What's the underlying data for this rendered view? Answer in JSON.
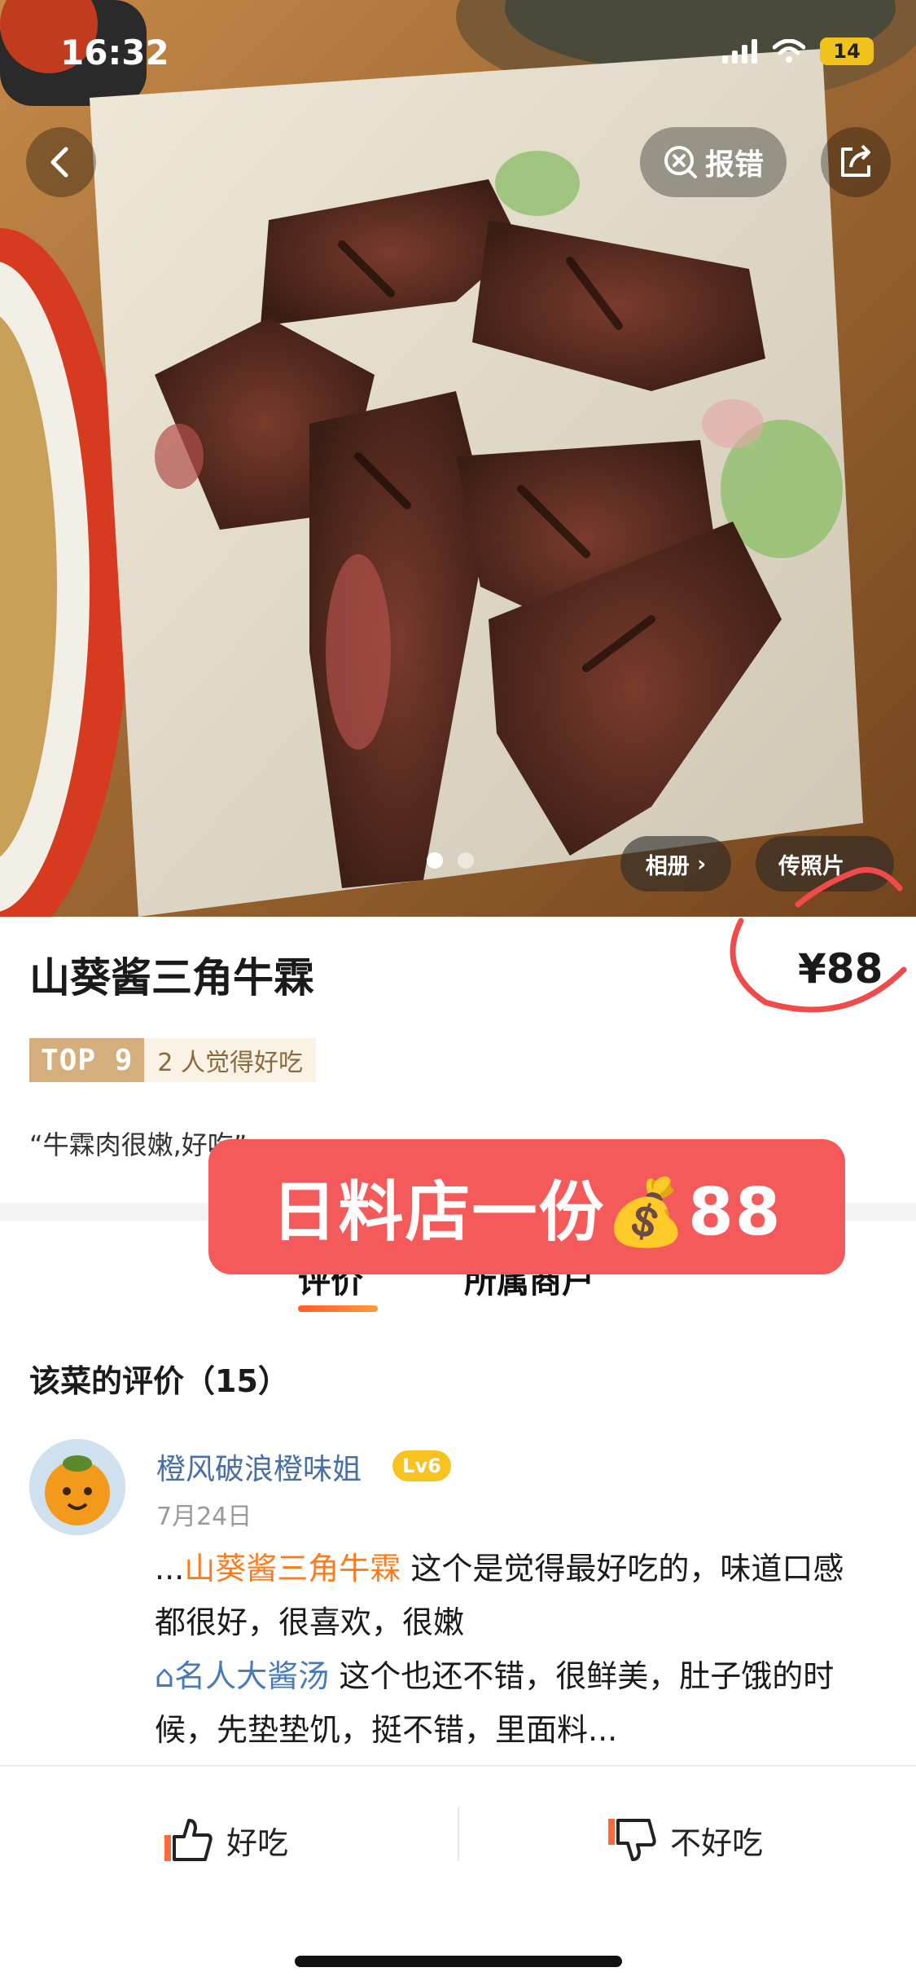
{
  "status_bar": {
    "time": "16:32",
    "battery": "14"
  },
  "header": {
    "report_label": "报错",
    "album_label": "相册",
    "upload_label": "传照片"
  },
  "gallery": {
    "total_pages": 2,
    "current_page": 1
  },
  "dish": {
    "name": "山葵酱三角牛霖",
    "price": "¥88",
    "rank_badge": "TOP 9",
    "like_text": "2 人觉得好吃",
    "quote": "“牛霖肉很嫩,好吃”"
  },
  "overlay": {
    "banner_text": "日料店一份💰88"
  },
  "tabs": [
    {
      "label": "评价",
      "active": true
    },
    {
      "label": "所属商户",
      "active": false
    }
  ],
  "reviews_section": {
    "title": "该菜的评价（15）"
  },
  "review": {
    "user": "橙风破浪橙味姐",
    "level": "Lv6",
    "date": "7月24日",
    "prefix": "...",
    "dish_link": "山葵酱三角牛霖",
    "text1": " 这个是觉得最好吃的，味道口感都很好，很喜欢，很嫩",
    "dish_link2": "名人大酱汤",
    "text2": " 这个也还不错，很鲜美，肚子饿的时候，先垫垫饥，挺不错，里面料..."
  },
  "actions": {
    "good_label": "好吃",
    "bad_label": "不好吃"
  },
  "colors": {
    "accent": "#ff7a1a",
    "banner": "#f45a5a",
    "link": "#4a79b8",
    "badge_gold": "#d5ae7d",
    "level_yellow": "#f8c21f"
  }
}
